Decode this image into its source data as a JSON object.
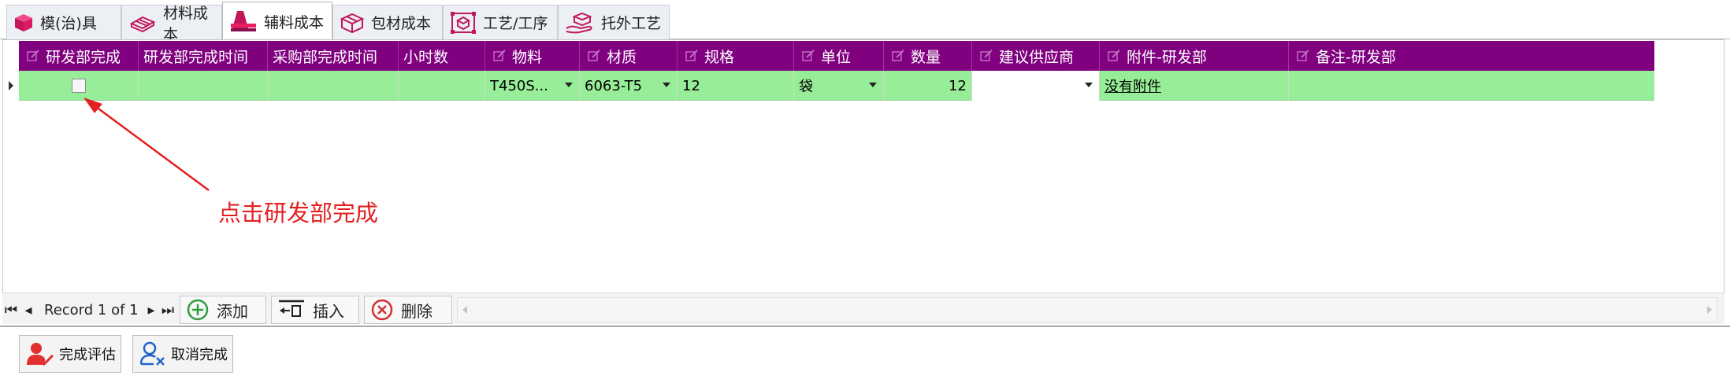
{
  "tabs": [
    {
      "label": "模(治)具",
      "icon": "cube-icon"
    },
    {
      "label": "材料成本",
      "icon": "material-stack-icon"
    },
    {
      "label": "辅料成本",
      "icon": "accessory-material-icon"
    },
    {
      "label": "包材成本",
      "icon": "package-box-icon"
    },
    {
      "label": "工艺/工序",
      "icon": "process-icon"
    },
    {
      "label": "托外工艺",
      "icon": "outsource-hand-icon"
    }
  ],
  "active_tab": "辅料成本",
  "columns": [
    "研发部完成",
    "研发部完成时间",
    "采购部完成时间",
    "小时数",
    "物料",
    "材质",
    "规格",
    "单位",
    "数量",
    "建议供应商",
    "附件-研发部",
    "备注-研发部"
  ],
  "row": {
    "material": "T450S...",
    "texture": "6063-T5",
    "spec": "12",
    "unit": "袋",
    "quantity": "12",
    "attachment": "没有附件"
  },
  "navigator": {
    "record_text": "Record 1 of 1",
    "add_label": "添加",
    "insert_label": "插入",
    "delete_label": "删除"
  },
  "footer": {
    "complete_label": "完成评估",
    "cancel_label": "取消完成"
  },
  "annotation": "点击研发部完成",
  "colors": {
    "header_bg": "#800080",
    "row_bg": "#98ee98",
    "annotation": "#e32020"
  }
}
